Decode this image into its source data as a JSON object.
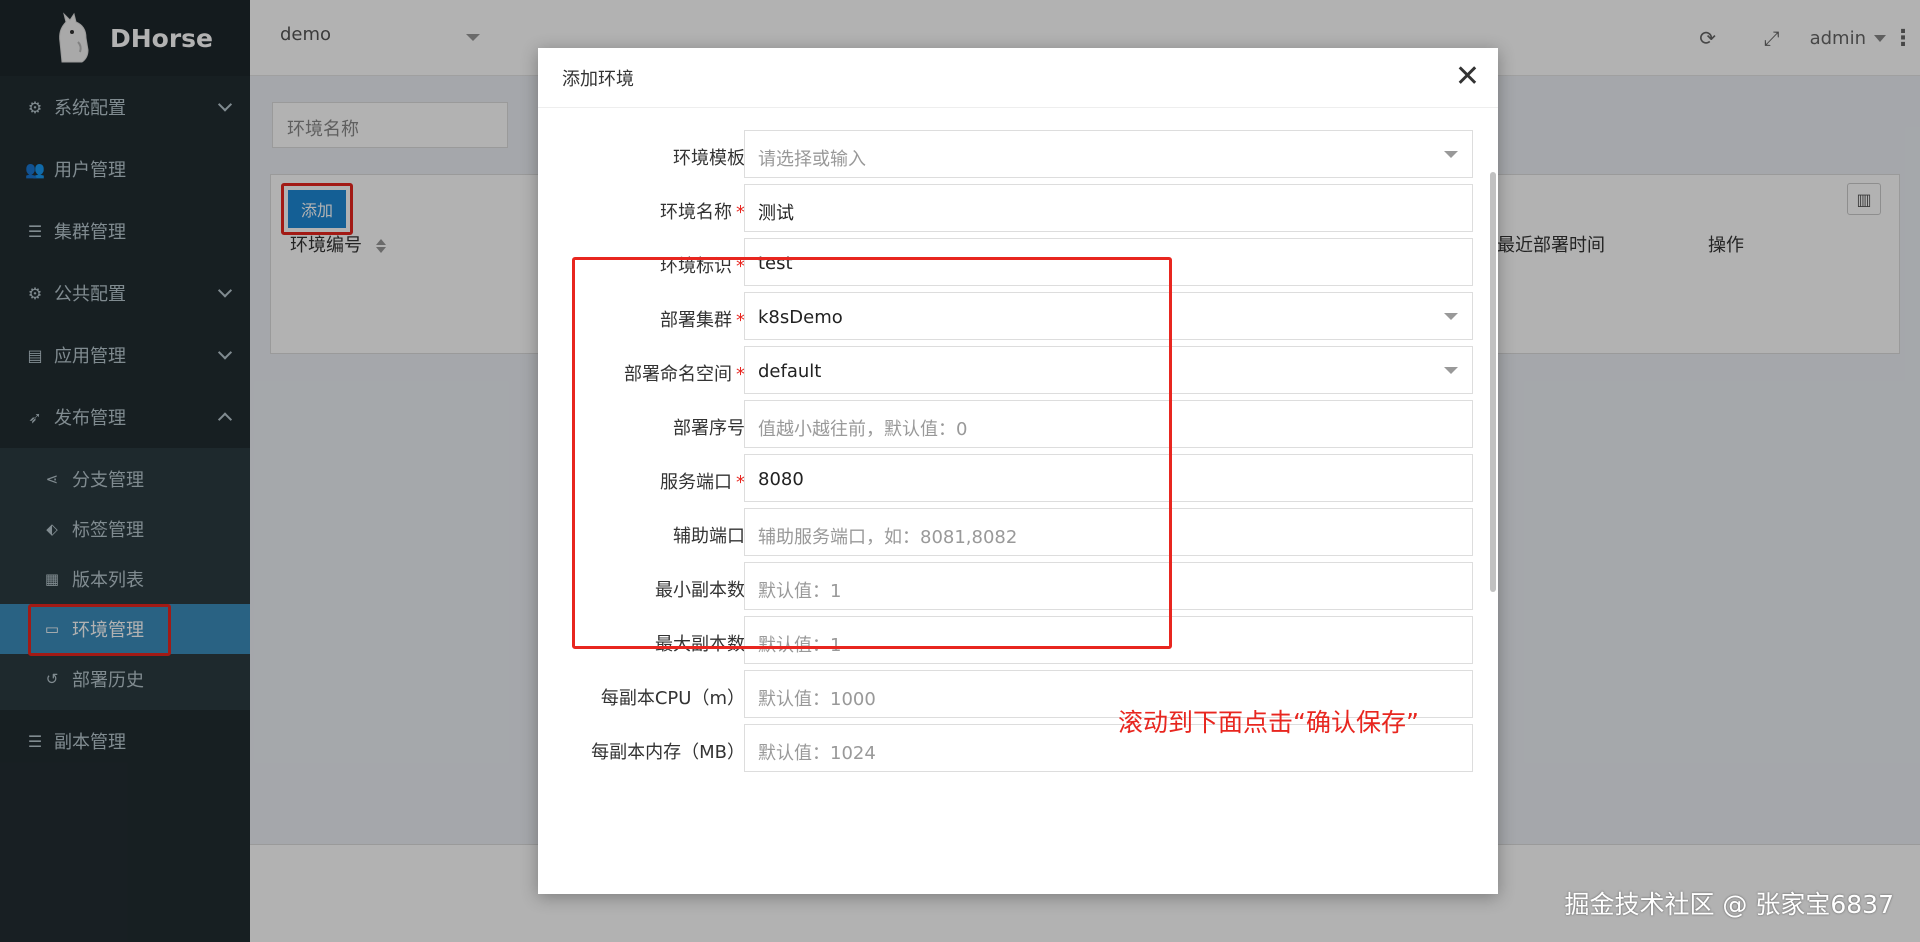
{
  "app": {
    "name": "DHorse"
  },
  "sidebar": {
    "items": [
      {
        "label": "系统配置",
        "icon": "cogs-icon",
        "expandable": true
      },
      {
        "label": "用户管理",
        "icon": "users-icon"
      },
      {
        "label": "集群管理",
        "icon": "list-icon"
      },
      {
        "label": "公共配置",
        "icon": "cogs-icon",
        "expandable": true
      },
      {
        "label": "应用管理",
        "icon": "file-icon",
        "expandable": true
      },
      {
        "label": "发布管理",
        "icon": "rocket-icon",
        "expanded": true
      }
    ],
    "sub_items": [
      {
        "label": "分支管理",
        "icon": "share-icon"
      },
      {
        "label": "标签管理",
        "icon": "tag-icon"
      },
      {
        "label": "版本列表",
        "icon": "grid-icon"
      },
      {
        "label": "环境管理",
        "icon": "laptop-icon",
        "active": true
      },
      {
        "label": "部署历史",
        "icon": "history-icon"
      }
    ],
    "bottom_item": {
      "label": "副本管理",
      "icon": "list-icon"
    }
  },
  "topbar": {
    "project": "demo",
    "user": "admin"
  },
  "content": {
    "search_placeholder": "环境名称",
    "add_label": "添加",
    "columns": {
      "env_no": "环境编号",
      "last_deploy": "最近部署时间",
      "actions": "操作"
    }
  },
  "modal": {
    "title": "添加环境",
    "fields": [
      {
        "label": "环境模板",
        "required": false,
        "value": "",
        "placeholder": "请选择或输入",
        "select": true
      },
      {
        "label": "环境名称",
        "required": true,
        "value": "测试",
        "placeholder": ""
      },
      {
        "label": "环境标识",
        "required": true,
        "value": "test",
        "placeholder": ""
      },
      {
        "label": "部署集群",
        "required": true,
        "value": "k8sDemo",
        "placeholder": "",
        "select": true
      },
      {
        "label": "部署命名空间",
        "required": true,
        "value": "default",
        "placeholder": "",
        "select": true
      },
      {
        "label": "部署序号",
        "required": false,
        "value": "",
        "placeholder": "值越小越往前，默认值：0"
      },
      {
        "label": "服务端口",
        "required": true,
        "value": "8080",
        "placeholder": ""
      },
      {
        "label": "辅助端口",
        "required": false,
        "value": "",
        "placeholder": "辅助服务端口，如：8081,8082"
      },
      {
        "label": "最小副本数",
        "required": false,
        "value": "",
        "placeholder": "默认值：1"
      },
      {
        "label": "最大副本数",
        "required": false,
        "value": "",
        "placeholder": "默认值：1"
      },
      {
        "label": "每副本CPU（m）",
        "required": false,
        "value": "",
        "placeholder": "默认值：1000"
      },
      {
        "label": "每副本内存（MB）",
        "required": false,
        "value": "",
        "placeholder": "默认值：1024"
      }
    ],
    "annotation": "滚动到下面点击“确认保存”"
  },
  "credit": "掘金技术社区 @ 张家宝6837",
  "colors": {
    "accent": "#3c8dbc",
    "highlight": "#e8261f",
    "sidebar_bg": "#222d32"
  }
}
